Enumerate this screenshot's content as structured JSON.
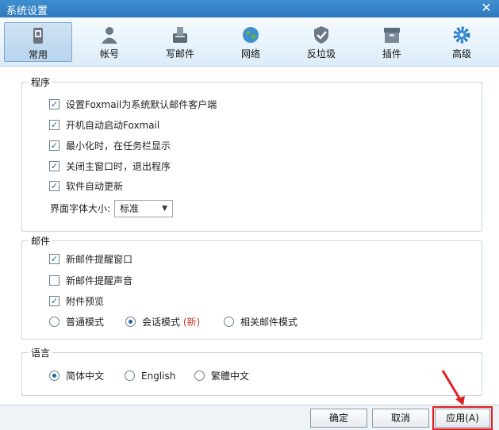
{
  "window": {
    "title": "系统设置"
  },
  "tabs": [
    {
      "label": "常用",
      "icon": "phone-icon"
    },
    {
      "label": "帐号",
      "icon": "user-icon"
    },
    {
      "label": "写邮件",
      "icon": "compose-icon"
    },
    {
      "label": "网络",
      "icon": "globe-icon"
    },
    {
      "label": "反垃圾",
      "icon": "shield-icon"
    },
    {
      "label": "插件",
      "icon": "box-icon"
    },
    {
      "label": "高级",
      "icon": "gear-icon"
    }
  ],
  "program": {
    "title": "程序",
    "items": [
      {
        "label": "设置Foxmail为系统默认邮件客户端",
        "checked": true
      },
      {
        "label": "开机自动启动Foxmail",
        "checked": true
      },
      {
        "label": "最小化时，在任务栏显示",
        "checked": true
      },
      {
        "label": "关闭主窗口时，退出程序",
        "checked": true
      },
      {
        "label": "软件自动更新",
        "checked": true
      }
    ],
    "font_size_label": "界面字体大小:",
    "font_size_value": "标准"
  },
  "mail": {
    "title": "邮件",
    "items": [
      {
        "label": "新邮件提醒窗口",
        "checked": true
      },
      {
        "label": "新邮件提醒声音",
        "checked": false
      },
      {
        "label": "附件预览",
        "checked": true
      }
    ],
    "modes": [
      {
        "label": "普通模式",
        "selected": false
      },
      {
        "label": "会话模式",
        "tag": "(新)",
        "selected": true
      },
      {
        "label": "相关邮件模式",
        "selected": false
      }
    ]
  },
  "language": {
    "title": "语言",
    "options": [
      {
        "label": "简体中文",
        "selected": true
      },
      {
        "label": "English",
        "selected": false
      },
      {
        "label": "繁體中文",
        "selected": false
      }
    ]
  },
  "buttons": {
    "ok": "确定",
    "cancel": "取消",
    "apply": "应用(A)"
  },
  "colors": {
    "titlebar": "#2e79bd",
    "highlight": "#e02020"
  }
}
